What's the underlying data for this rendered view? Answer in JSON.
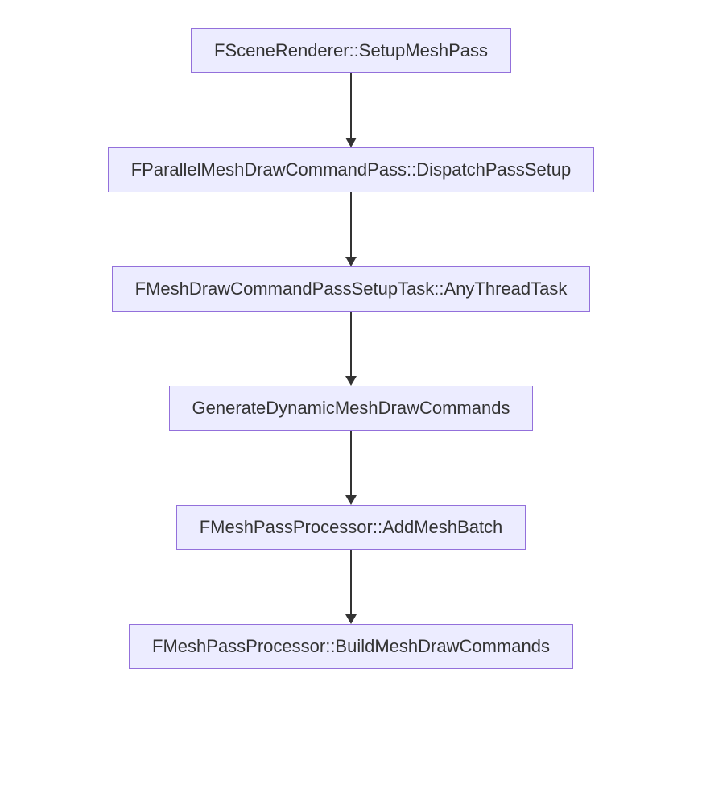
{
  "diagram": {
    "nodes": [
      {
        "label": "FSceneRenderer::SetupMeshPass"
      },
      {
        "label": "FParallelMeshDrawCommandPass::DispatchPassSetup"
      },
      {
        "label": "FMeshDrawCommandPassSetupTask::AnyThreadTask"
      },
      {
        "label": "GenerateDynamicMeshDrawCommands"
      },
      {
        "label": "FMeshPassProcessor::AddMeshBatch"
      },
      {
        "label": "FMeshPassProcessor::BuildMeshDrawCommands"
      }
    ],
    "colors": {
      "node_bg": "#ECECFF",
      "node_border": "#9370DB",
      "arrow": "#333333"
    }
  }
}
